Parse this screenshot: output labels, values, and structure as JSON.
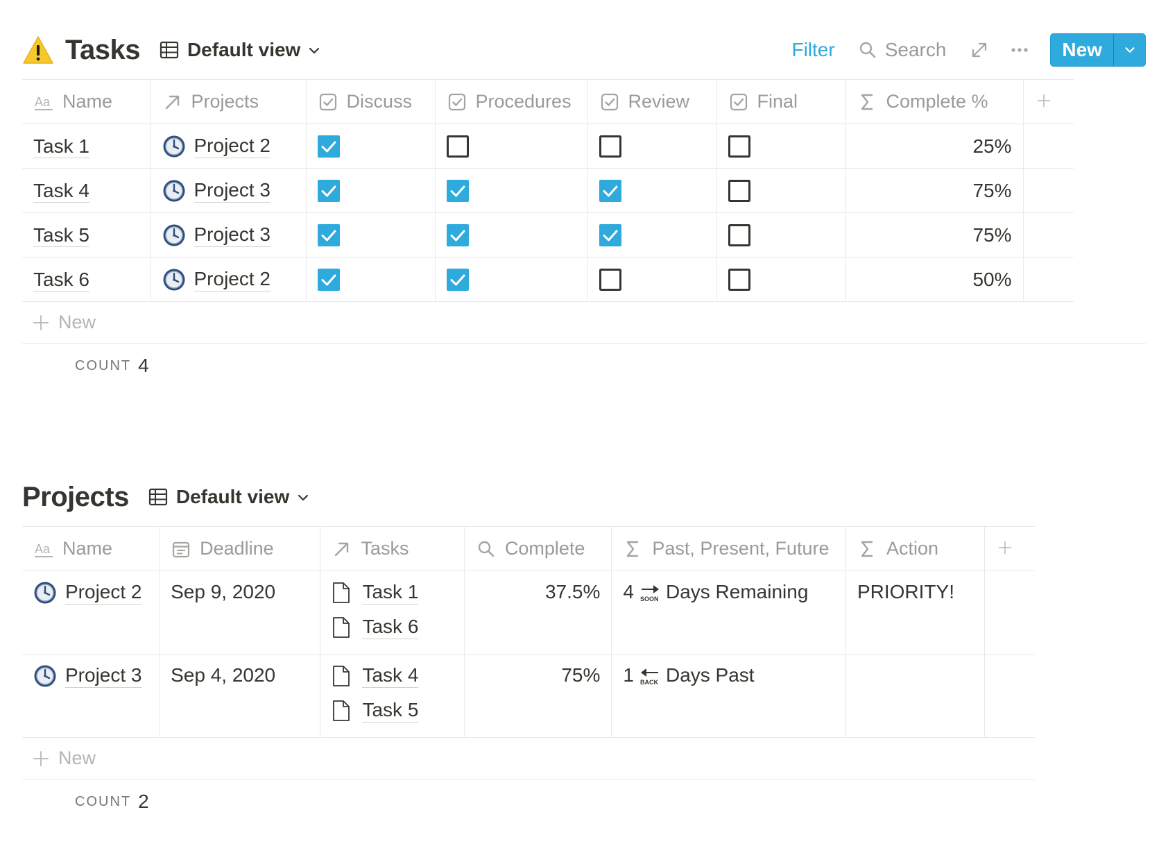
{
  "tasks": {
    "title": "Tasks",
    "view_label": "Default view",
    "toolbar": {
      "filter": "Filter",
      "search": "Search",
      "new": "New"
    },
    "columns": [
      {
        "label": "Name",
        "icon": "text-aa-icon"
      },
      {
        "label": "Projects",
        "icon": "relation-arrow-icon"
      },
      {
        "label": "Discuss",
        "icon": "checkbox-property-icon"
      },
      {
        "label": "Procedures",
        "icon": "checkbox-property-icon"
      },
      {
        "label": "Review",
        "icon": "checkbox-property-icon"
      },
      {
        "label": "Final",
        "icon": "checkbox-property-icon"
      },
      {
        "label": "Complete %",
        "icon": "sigma-icon"
      }
    ],
    "rows": [
      {
        "name": "Task 1",
        "project": "Project 2",
        "discuss": true,
        "procedures": false,
        "review": false,
        "final": false,
        "complete": "25%"
      },
      {
        "name": "Task 4",
        "project": "Project 3",
        "discuss": true,
        "procedures": true,
        "review": true,
        "final": false,
        "complete": "75%"
      },
      {
        "name": "Task 5",
        "project": "Project 3",
        "discuss": true,
        "procedures": true,
        "review": true,
        "final": false,
        "complete": "75%"
      },
      {
        "name": "Task 6",
        "project": "Project 2",
        "discuss": true,
        "procedures": true,
        "review": false,
        "final": false,
        "complete": "50%"
      }
    ],
    "new_row_label": "New",
    "count_label": "COUNT",
    "count_value": "4"
  },
  "projects": {
    "title": "Projects",
    "view_label": "Default view",
    "columns": [
      {
        "label": "Name",
        "icon": "text-aa-icon"
      },
      {
        "label": "Deadline",
        "icon": "calendar-icon"
      },
      {
        "label": "Tasks",
        "icon": "relation-arrow-icon"
      },
      {
        "label": "Complete",
        "icon": "search-icon"
      },
      {
        "label": "Past, Present, Future",
        "icon": "sigma-icon"
      },
      {
        "label": "Action",
        "icon": "sigma-icon"
      }
    ],
    "rows": [
      {
        "name": "Project 2",
        "deadline": "Sep 9, 2020",
        "tasks": [
          "Task 1",
          "Task 6"
        ],
        "complete": "37.5%",
        "days_count": "4",
        "days_label": "Days Remaining",
        "days_icon": "soon-arrow-icon",
        "action": "PRIORITY!"
      },
      {
        "name": "Project 3",
        "deadline": "Sep 4, 2020",
        "tasks": [
          "Task 4",
          "Task 5"
        ],
        "complete": "75%",
        "days_count": "1",
        "days_label": "Days Past",
        "days_icon": "back-arrow-icon",
        "action": ""
      }
    ],
    "new_row_label": "New",
    "count_label": "COUNT",
    "count_value": "2"
  },
  "colors": {
    "accent": "#2eaadc",
    "text": "#37352f",
    "muted": "#9b9a97",
    "border": "#e9e9e7"
  }
}
